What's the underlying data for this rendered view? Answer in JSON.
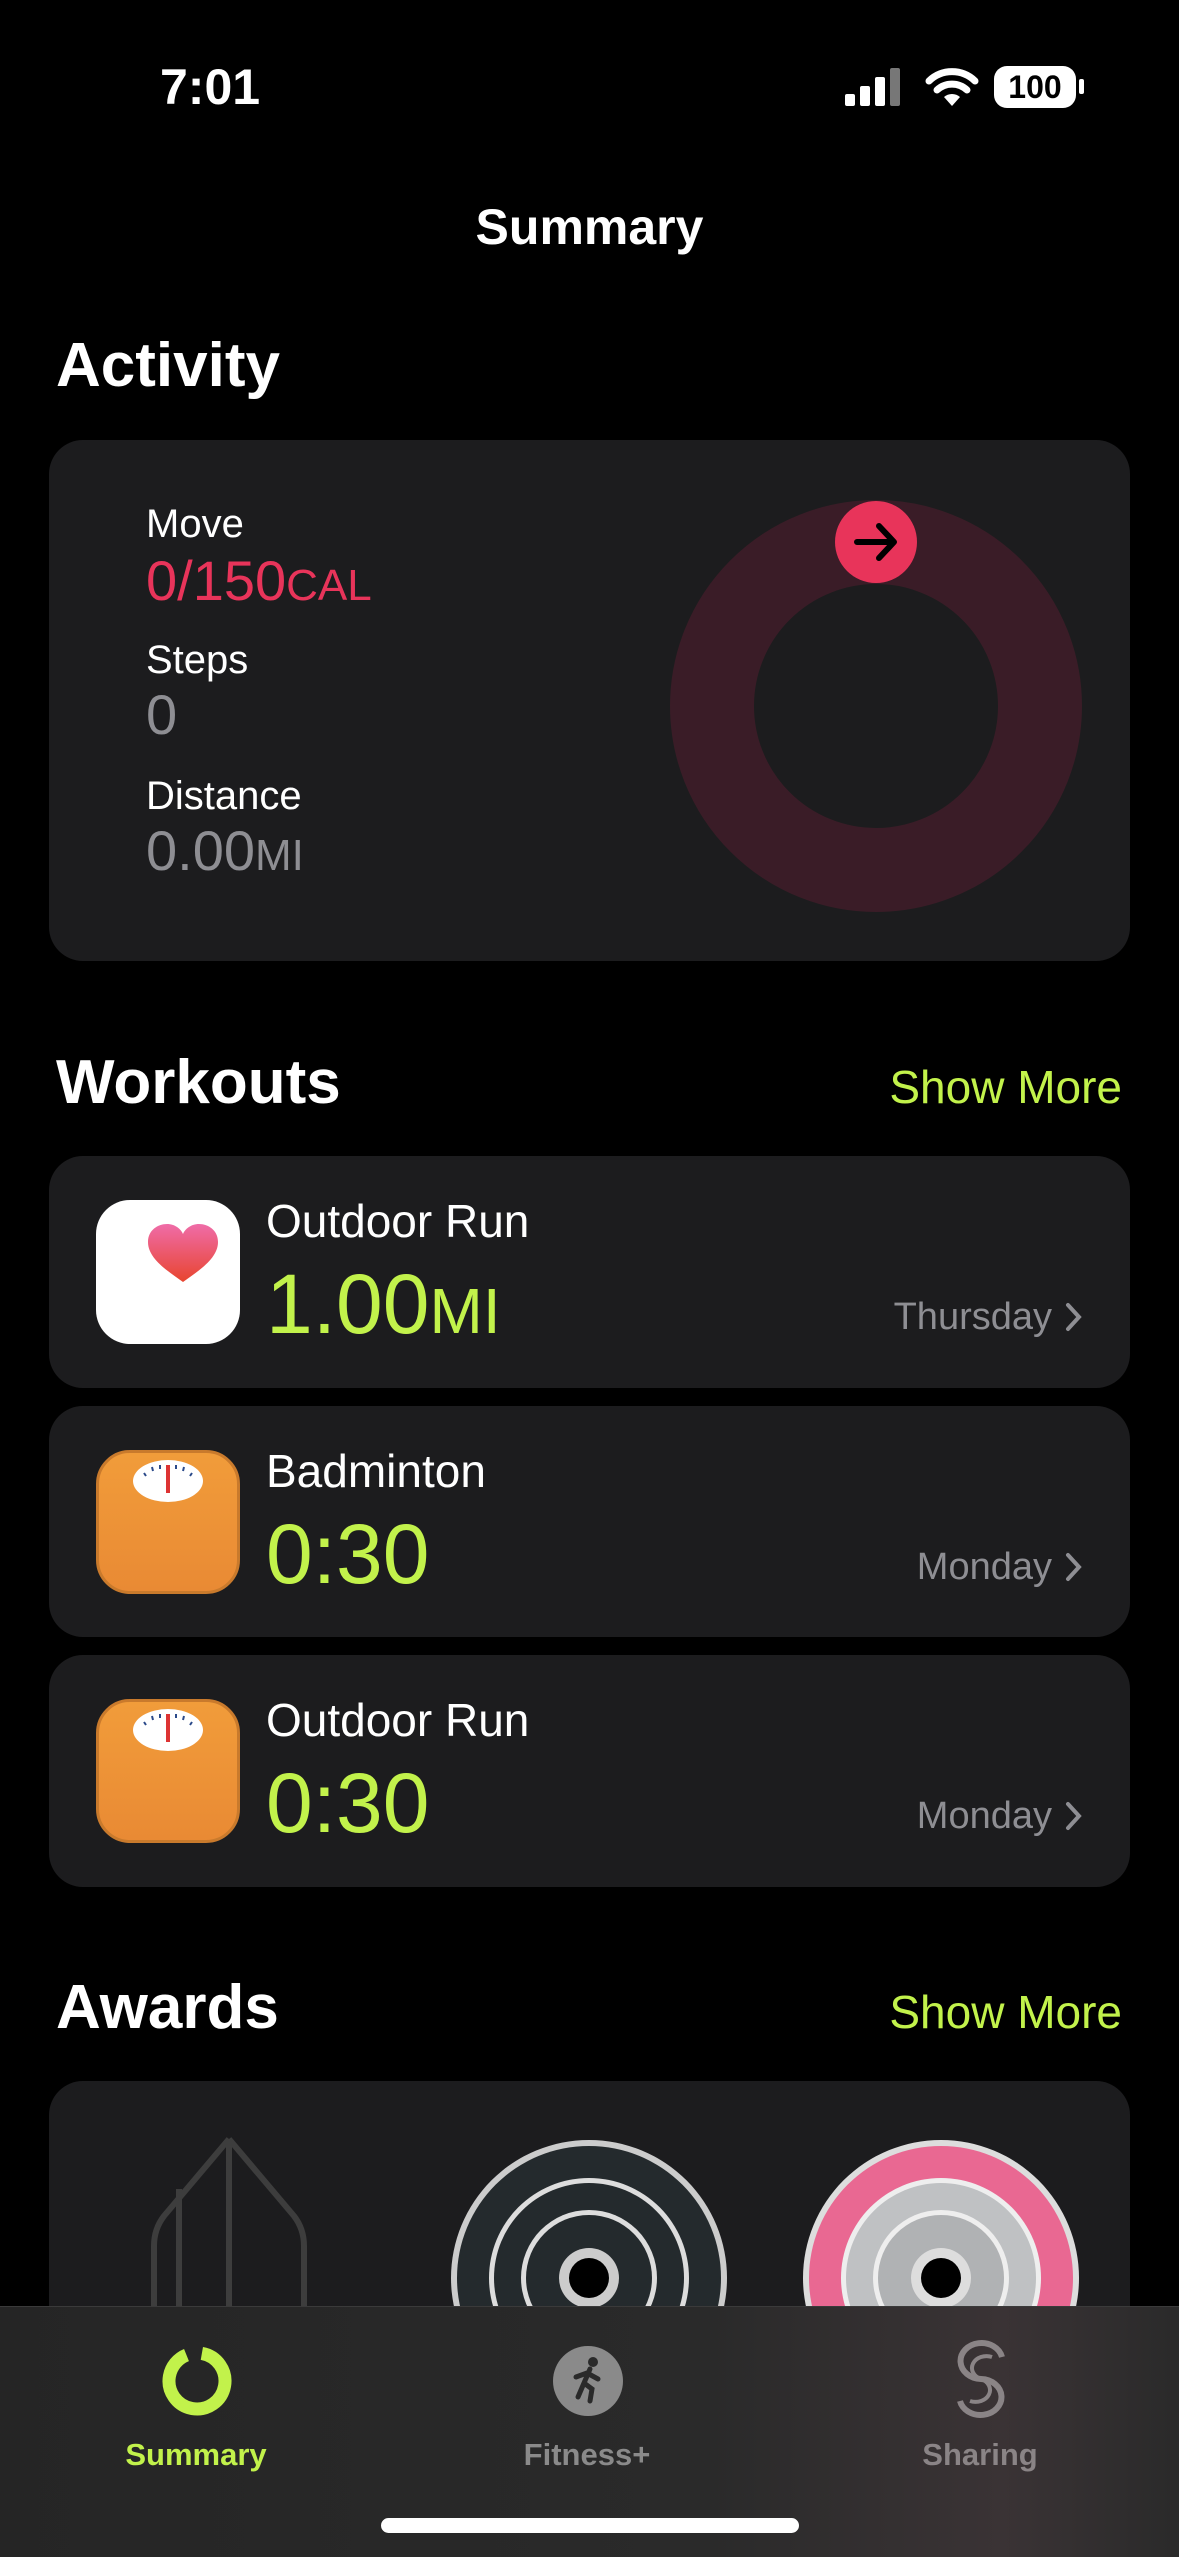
{
  "status_bar": {
    "time": "7:01",
    "battery": "100"
  },
  "nav": {
    "title": "Summary"
  },
  "activity": {
    "heading": "Activity",
    "move": {
      "label": "Move",
      "value": "0/150",
      "unit": "CAL",
      "progress": 0,
      "goal": 150
    },
    "steps": {
      "label": "Steps",
      "value": "0"
    },
    "distance": {
      "label": "Distance",
      "value": "0.00",
      "unit": "MI"
    }
  },
  "workouts": {
    "heading": "Workouts",
    "show_more": "Show More",
    "items": [
      {
        "name": "Outdoor Run",
        "value": "1.00",
        "unit": "MI",
        "day": "Thursday",
        "icon": "health-heart-icon"
      },
      {
        "name": "Badminton",
        "value": "0:30",
        "unit": "",
        "day": "Monday",
        "icon": "scale-icon"
      },
      {
        "name": "Outdoor Run",
        "value": "0:30",
        "unit": "",
        "day": "Monday",
        "icon": "scale-icon"
      }
    ]
  },
  "awards": {
    "heading": "Awards",
    "show_more": "Show More"
  },
  "tabs": [
    {
      "label": "Summary",
      "icon": "activity-ring-icon",
      "active": true
    },
    {
      "label": "Fitness+",
      "icon": "runner-icon",
      "active": false
    },
    {
      "label": "Sharing",
      "icon": "sharing-icon",
      "active": false
    }
  ],
  "colors": {
    "accent_green": "#c2f24b",
    "move_red": "#e8345a",
    "ring_bg": "#3a1c27",
    "card_bg": "#1c1c1e",
    "orange_icon": "#ee9738"
  }
}
